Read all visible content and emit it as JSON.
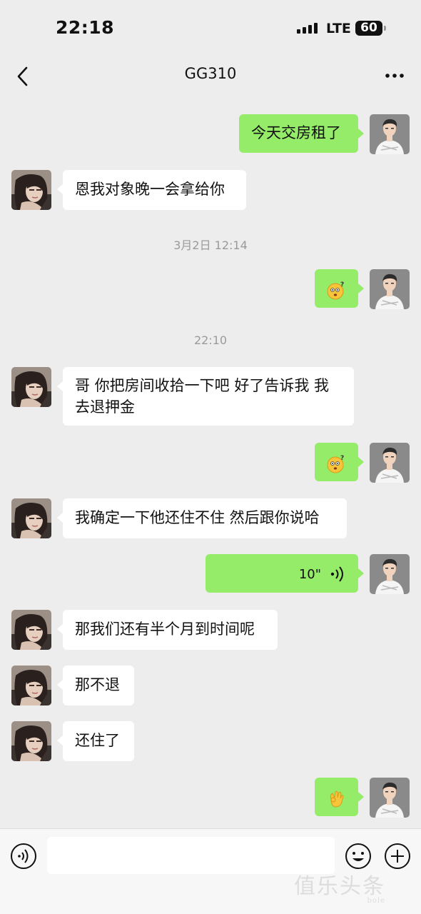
{
  "status_bar": {
    "time": "22:18",
    "network": "LTE",
    "battery": "60"
  },
  "nav": {
    "title": "GG310",
    "back_icon": "chevron-left-icon",
    "more_icon": "more-icon"
  },
  "messages": [
    {
      "side": "out",
      "type": "text",
      "text": "今天交房租了"
    },
    {
      "side": "in",
      "type": "text",
      "text": "恩我对象晚一会拿给你"
    },
    {
      "type": "timestamp",
      "text": "3月2日 12:14"
    },
    {
      "side": "out",
      "type": "emoji",
      "emoji": "confused-face-emoji"
    },
    {
      "type": "timestamp",
      "text": "22:10"
    },
    {
      "side": "in",
      "type": "text",
      "text": "哥 你把房间收拾一下吧 好了告诉我 我去退押金"
    },
    {
      "side": "out",
      "type": "emoji",
      "emoji": "confused-face-emoji"
    },
    {
      "side": "in",
      "type": "text",
      "text": "我确定一下他还住不住 然后跟你说哈"
    },
    {
      "side": "out",
      "type": "voice",
      "duration": "10\""
    },
    {
      "side": "in",
      "type": "text",
      "text": "那我们还有半个月到时间呢"
    },
    {
      "side": "in",
      "type": "text",
      "text": "那不退"
    },
    {
      "side": "in",
      "type": "text",
      "text": "还住了"
    },
    {
      "side": "out",
      "type": "emoji",
      "emoji": "ok-hand-emoji"
    }
  ],
  "input_bar": {
    "voice_icon": "voice-input-icon",
    "text_value": "",
    "emoji_icon": "smiley-icon",
    "plus_icon": "plus-icon"
  },
  "watermark": {
    "text": "值乐头条",
    "sub": "bole"
  },
  "colors": {
    "background": "#ededed",
    "outgoing_bubble": "#95ec69",
    "incoming_bubble": "#ffffff",
    "timestamp": "#9a9a9a"
  }
}
